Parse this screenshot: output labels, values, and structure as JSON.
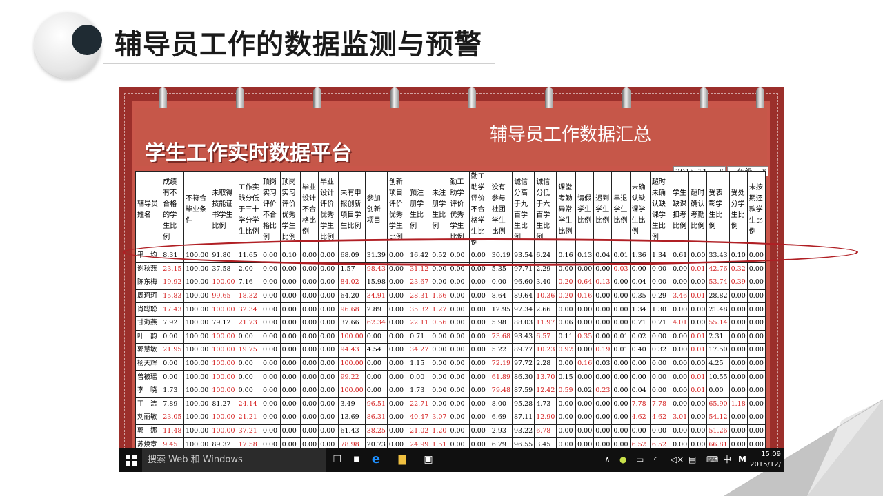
{
  "slide": {
    "title": "辅导员工作的数据监测与预警"
  },
  "platform": {
    "title": "学生工作实时数据平台",
    "summary_title": "辅导员工作数据汇总",
    "month_select": "2015-11",
    "grade_select": "---年级---"
  },
  "columns": [
    "辅导员姓名",
    "成绩有不合格的学生比例",
    "不符合毕业条件",
    "未取得技能证书学生比例",
    "工作实践分低于三十学分学生比例",
    "顶岗实习评价不合格比例",
    "顶岗实习评价优秀学生比例",
    "毕业设计不合格比例",
    "毕业设计评价优秀学生比例",
    "未有申报创新项目学生比例",
    "参加创新项目",
    "创新项目评价优秀学生比例",
    "预注册学生比例",
    "未注册学生比例",
    "勤工助学评价优秀学生比例",
    "勤工助学评价不合格学生比例",
    "没有参与社团学生比例",
    "诚信分高于九百学生比例",
    "诚信分低于六百学生比例",
    "课堂考勤异常学生比例",
    "请假学生比例",
    "迟到学生比例",
    "早退学生比例",
    "未确认缺课学生比例",
    "超时未确认缺课学生比例",
    "学生缺课扣考比例",
    "超时确认考勤比例",
    "受表彰学生比例",
    "受处分学生比例",
    "未按期还款学生比例"
  ],
  "rows": [
    [
      "平　均",
      "8.31",
      "100.00",
      "91.80",
      "11.65",
      "0.00",
      "0.10",
      "0.00",
      "0.00",
      "68.09",
      "31.39",
      "0.00",
      "16.42",
      "0.52",
      "0.00",
      "0.00",
      "30.19",
      "93.54",
      "6.24",
      "0.16",
      "0.13",
      "0.04",
      "0.01",
      "1.36",
      "1.34",
      "0.61",
      "0.00",
      "33.43",
      "0.10",
      "0.00"
    ],
    [
      "谢秋燕",
      "23.15",
      "100.00",
      "37.58",
      "2.00",
      "0.00",
      "0.00",
      "0.00",
      "0.00",
      "1.57",
      "98.43",
      "0.00",
      "31.12",
      "0.00",
      "0.00",
      "0.00",
      "5.35",
      "97.71",
      "2.29",
      "0.00",
      "0.00",
      "0.00",
      "0.03",
      "0.00",
      "0.00",
      "0.00",
      "0.01",
      "42.76",
      "0.32",
      "0.00"
    ],
    [
      "陈东梅",
      "19.92",
      "100.00",
      "100.00",
      "7.16",
      "0.00",
      "0.00",
      "0.00",
      "0.00",
      "84.02",
      "15.98",
      "0.00",
      "23.67",
      "0.00",
      "0.00",
      "0.00",
      "0.00",
      "96.60",
      "3.40",
      "0.20",
      "0.64",
      "0.13",
      "0.00",
      "0.04",
      "0.00",
      "0.00",
      "0.00",
      "53.74",
      "0.39",
      "0.00"
    ],
    [
      "周珂珂",
      "15.83",
      "100.00",
      "99.65",
      "18.32",
      "0.00",
      "0.00",
      "0.00",
      "0.00",
      "64.20",
      "34.91",
      "0.00",
      "28.31",
      "1.66",
      "0.00",
      "0.00",
      "8.64",
      "89.64",
      "10.36",
      "0.20",
      "0.16",
      "0.00",
      "0.00",
      "0.35",
      "0.29",
      "3.46",
      "0.01",
      "28.82",
      "0.00",
      "0.00"
    ],
    [
      "肖聪聪",
      "17.43",
      "100.00",
      "100.00",
      "32.34",
      "0.00",
      "0.00",
      "0.00",
      "0.00",
      "96.68",
      "2.89",
      "0.00",
      "35.32",
      "1.27",
      "0.00",
      "0.00",
      "12.95",
      "97.34",
      "2.66",
      "0.00",
      "0.00",
      "0.00",
      "0.00",
      "1.34",
      "1.30",
      "0.00",
      "0.00",
      "21.48",
      "0.00",
      "0.00"
    ],
    [
      "甘海燕",
      "7.92",
      "100.00",
      "79.12",
      "21.73",
      "0.00",
      "0.00",
      "0.00",
      "0.00",
      "37.66",
      "62.34",
      "0.00",
      "22.11",
      "0.56",
      "0.00",
      "0.00",
      "5.98",
      "88.03",
      "11.97",
      "0.06",
      "0.00",
      "0.00",
      "0.00",
      "0.71",
      "0.71",
      "4.01",
      "0.00",
      "55.14",
      "0.00",
      "0.00"
    ],
    [
      "叶　韵",
      "0.00",
      "100.00",
      "100.00",
      "0.00",
      "0.00",
      "0.00",
      "0.00",
      "0.00",
      "100.00",
      "0.00",
      "0.00",
      "0.71",
      "0.00",
      "0.00",
      "0.00",
      "73.68",
      "93.43",
      "6.57",
      "0.11",
      "0.35",
      "0.00",
      "0.01",
      "0.02",
      "0.00",
      "0.00",
      "0.01",
      "2.31",
      "0.00",
      "0.00"
    ],
    [
      "郭慧敏",
      "21.95",
      "100.00",
      "100.00",
      "19.75",
      "0.00",
      "0.00",
      "0.00",
      "0.00",
      "94.43",
      "4.54",
      "0.00",
      "34.27",
      "0.00",
      "0.00",
      "0.00",
      "5.22",
      "89.77",
      "10.23",
      "0.92",
      "0.00",
      "0.19",
      "0.01",
      "0.40",
      "0.32",
      "0.00",
      "0.01",
      "17.50",
      "0.00",
      "0.00"
    ],
    [
      "杨天辉",
      "0.00",
      "100.00",
      "100.00",
      "0.00",
      "0.00",
      "0.00",
      "0.00",
      "0.00",
      "100.00",
      "0.00",
      "0.00",
      "1.15",
      "0.00",
      "0.00",
      "0.00",
      "72.19",
      "97.72",
      "2.28",
      "0.00",
      "0.16",
      "0.03",
      "0.00",
      "0.00",
      "0.00",
      "0.00",
      "0.00",
      "4.25",
      "0.00",
      "0.00"
    ],
    [
      "曾被瑶",
      "0.00",
      "100.00",
      "100.00",
      "0.00",
      "0.00",
      "0.00",
      "0.00",
      "0.00",
      "99.22",
      "0.00",
      "0.00",
      "0.00",
      "0.00",
      "0.00",
      "0.00",
      "61.89",
      "86.30",
      "13.70",
      "0.15",
      "0.00",
      "0.00",
      "0.00",
      "0.00",
      "0.00",
      "0.00",
      "0.01",
      "10.55",
      "0.00",
      "0.00"
    ],
    [
      "李　晓",
      "1.73",
      "100.00",
      "100.00",
      "0.00",
      "0.00",
      "0.00",
      "0.00",
      "0.00",
      "100.00",
      "0.00",
      "0.00",
      "1.73",
      "0.00",
      "0.00",
      "0.00",
      "79.48",
      "87.59",
      "12.42",
      "0.59",
      "0.02",
      "0.23",
      "0.00",
      "0.04",
      "0.00",
      "0.00",
      "0.01",
      "0.00",
      "0.00",
      "0.00"
    ],
    [
      "丁　洁",
      "7.89",
      "100.00",
      "81.27",
      "24.14",
      "0.00",
      "0.00",
      "0.00",
      "0.00",
      "3.49",
      "96.51",
      "0.00",
      "22.71",
      "0.00",
      "0.00",
      "0.00",
      "8.00",
      "95.28",
      "4.73",
      "0.00",
      "0.00",
      "0.00",
      "0.00",
      "7.78",
      "7.78",
      "0.00",
      "0.00",
      "65.90",
      "1.18",
      "0.00"
    ],
    [
      "刘丽敏",
      "23.05",
      "100.00",
      "100.00",
      "21.21",
      "0.00",
      "0.00",
      "0.00",
      "0.00",
      "13.69",
      "86.31",
      "0.00",
      "40.47",
      "3.07",
      "0.00",
      "0.00",
      "6.69",
      "87.11",
      "12.90",
      "0.00",
      "0.00",
      "0.00",
      "0.00",
      "4.62",
      "4.62",
      "3.01",
      "0.00",
      "54.12",
      "0.00",
      "0.00"
    ],
    [
      "郭　娜",
      "11.48",
      "100.00",
      "100.00",
      "37.21",
      "0.00",
      "0.00",
      "0.00",
      "0.00",
      "61.43",
      "38.25",
      "0.00",
      "21.02",
      "1.20",
      "0.00",
      "0.00",
      "2.93",
      "93.22",
      "6.78",
      "0.00",
      "0.00",
      "0.00",
      "0.00",
      "0.00",
      "0.00",
      "0.00",
      "0.00",
      "51.26",
      "0.00",
      "0.00"
    ],
    [
      "苏焕章",
      "9.45",
      "100.00",
      "89.32",
      "17.58",
      "0.00",
      "0.00",
      "0.00",
      "0.00",
      "78.98",
      "20.73",
      "0.00",
      "24.99",
      "1.51",
      "0.00",
      "0.00",
      "6.79",
      "96.55",
      "3.45",
      "0.00",
      "0.00",
      "0.00",
      "0.00",
      "6.52",
      "6.52",
      "0.00",
      "0.00",
      "66.81",
      "0.00",
      "0.00"
    ]
  ],
  "taskbar": {
    "search_placeholder": "搜索 Web 和 Windows",
    "ime": "中",
    "time": "15:09",
    "date": "2015/12/"
  },
  "colors": {
    "highlight": "#d42020",
    "frame": "#9b2f2b",
    "banner": "#c65749"
  }
}
